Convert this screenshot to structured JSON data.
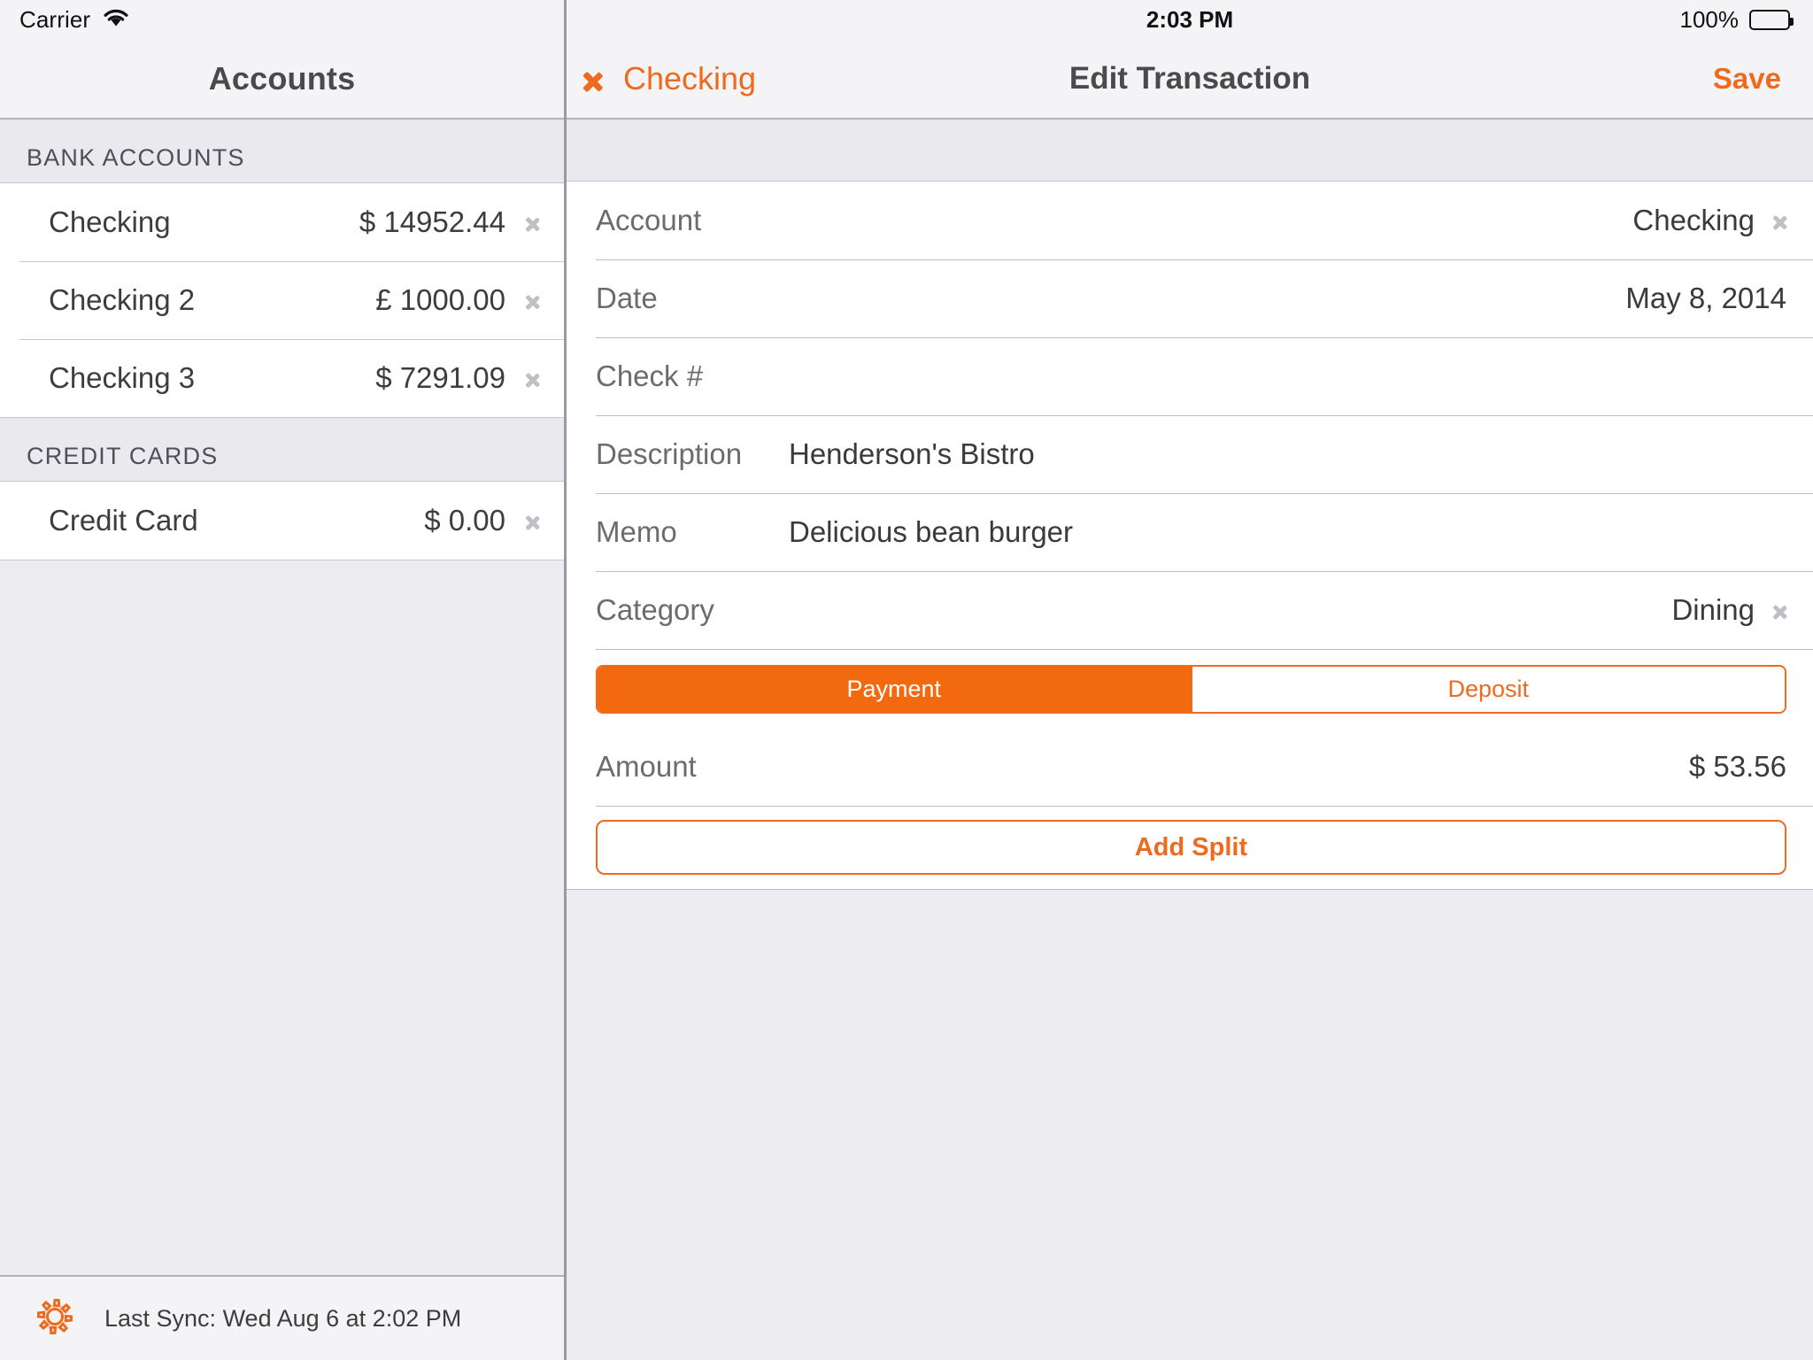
{
  "status_bar": {
    "carrier": "Carrier",
    "wifi_icon": "wifi-icon",
    "time": "2:03 PM",
    "battery_percent": "100%",
    "battery_icon": "battery-full-icon"
  },
  "sidebar": {
    "title": "Accounts",
    "sections": [
      {
        "header": "BANK ACCOUNTS",
        "rows": [
          {
            "name": "Checking",
            "balance": "$ 14952.44"
          },
          {
            "name": "Checking 2",
            "balance": "£ 1000.00"
          },
          {
            "name": "Checking 3",
            "balance": "$ 7291.09"
          }
        ]
      },
      {
        "header": "CREDIT CARDS",
        "rows": [
          {
            "name": "Credit Card",
            "balance": "$ 0.00"
          }
        ]
      }
    ],
    "footer": {
      "gear_icon": "gear-icon",
      "sync_text": "Last Sync: Wed Aug 6 at 2:02 PM"
    }
  },
  "detail": {
    "back_label": "Checking",
    "back_icon": "chevron-left-icon",
    "title": "Edit Transaction",
    "save_label": "Save",
    "form": {
      "account_label": "Account",
      "account_value": "Checking",
      "date_label": "Date",
      "date_value": "May 8, 2014",
      "check_label": "Check #",
      "check_value": "",
      "description_label": "Description",
      "description_value": "Henderson's Bistro",
      "memo_label": "Memo",
      "memo_value": "Delicious bean burger",
      "category_label": "Category",
      "category_value": "Dining",
      "segment_payment": "Payment",
      "segment_deposit": "Deposit",
      "segment_selected": "Payment",
      "amount_label": "Amount",
      "amount_value": "$ 53.56",
      "add_split_label": "Add Split"
    }
  },
  "colors": {
    "accent_orange": "#EE6A1E",
    "segment_fill": "#F2690F",
    "label_gray": "#6B6B70",
    "value_dark": "#3A3A3A",
    "chevron_gray": "#BFBFC6",
    "background": "#ECECF1",
    "bar_background": "#F4F4F7"
  }
}
